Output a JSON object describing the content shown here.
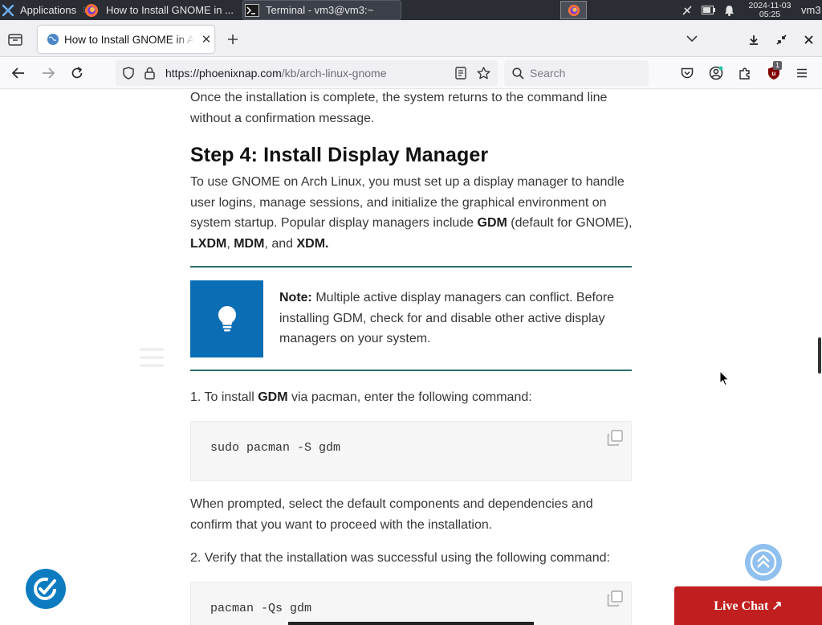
{
  "taskbar": {
    "applications_label": "Applications",
    "tasks": [
      {
        "label": "How to Install GNOME in ..."
      },
      {
        "label": "Terminal - vm3@vm3:~"
      }
    ],
    "date": "2024-11-03",
    "time": "05:25",
    "user": "vm3"
  },
  "browser": {
    "tab": {
      "title": "How to Install GNOME in Arch"
    },
    "url": {
      "domain": "https://phoenixnap.com",
      "path": "/kb/arch-linux-gnome"
    },
    "search": {
      "placeholder": "Search"
    },
    "extension_badge": "1"
  },
  "article": {
    "intro": "Once the installation is complete, the system returns to the command line without a confirmation message.",
    "heading": "Step 4: Install Display Manager",
    "para1": {
      "text_a": "To use GNOME on Arch Linux, you must set up a display manager to handle user logins, manage sessions, and initialize the graphical environment on system startup. Popular display managers include ",
      "gdm": "GDM",
      "text_b": " (default for GNOME), ",
      "lxdm": "LXDM",
      "sep": ", ",
      "mdm": "MDM",
      "and": ", and ",
      "xdm": "XDM."
    },
    "note": {
      "label": "Note:",
      "text": " Multiple active display managers can conflict. Before installing GDM, check for and disable other active display managers on your system."
    },
    "step1": {
      "prefix": "1. To install ",
      "bold": "GDM",
      "suffix": " via pacman, enter the following command:"
    },
    "code1": "sudo pacman -S gdm",
    "para2": "When prompted, select the default components and dependencies and confirm that you want to proceed with the installation.",
    "step2": "2. Verify that the installation was successful using the following command:",
    "code2": "pacman -Qs gdm"
  },
  "live_chat": {
    "label": "Live Chat ↗"
  },
  "colors": {
    "note_box": "#0b6eb5",
    "divider": "#2e6b6b",
    "live_chat": "#c11f1f",
    "scroll_top": "#8fc0ee"
  }
}
